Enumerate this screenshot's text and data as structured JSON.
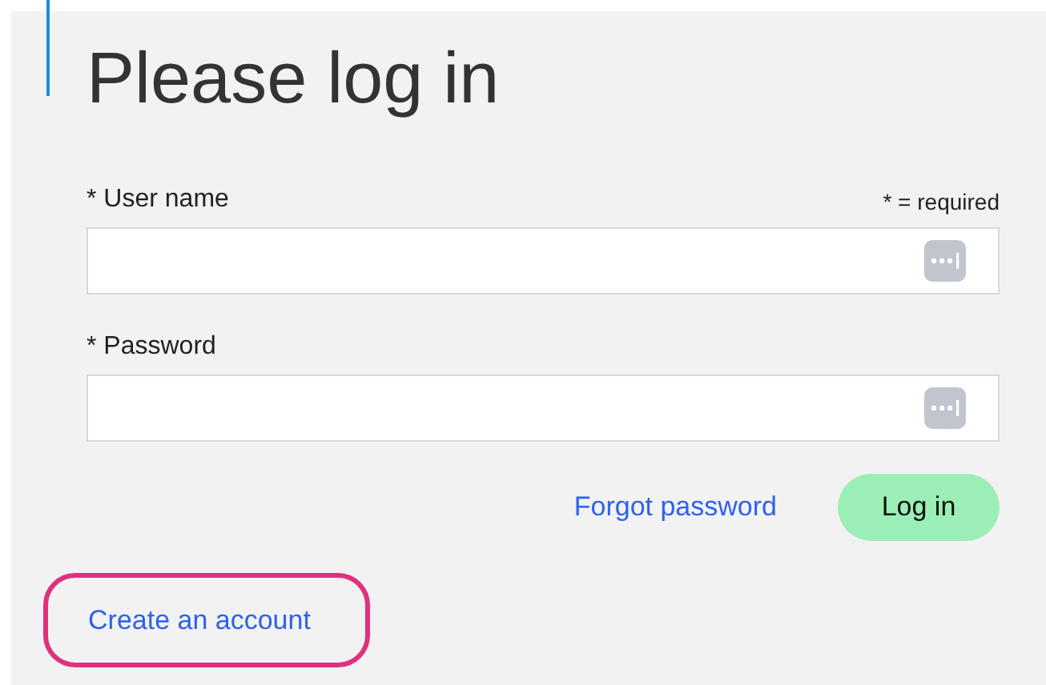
{
  "title": "Please log in",
  "required_note": "* = required",
  "fields": [
    {
      "label": "* User name"
    },
    {
      "label": "* Password"
    }
  ],
  "forgot_link": "Forgot password",
  "login_button": "Log in",
  "create_account_link": "Create an account",
  "create_account_highlighted": true
}
